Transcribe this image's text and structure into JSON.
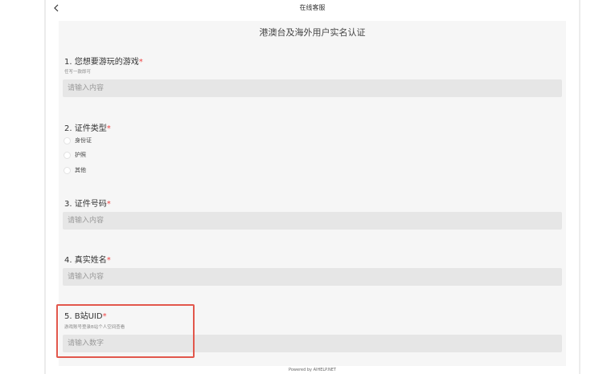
{
  "header": {
    "title": "在线客服"
  },
  "form": {
    "title": "港澳台及海外用户实名认证",
    "required_mark": "*",
    "questions": [
      {
        "label": "1. 您想要游玩的游戏",
        "hint": "任写一款即可",
        "placeholder": "请输入内容"
      },
      {
        "label": "2. 证件类型",
        "options": [
          "身份证",
          "护照",
          "其他"
        ]
      },
      {
        "label": "3. 证件号码",
        "placeholder": "请输入内容"
      },
      {
        "label": "4. 真实姓名",
        "placeholder": "请输入内容"
      },
      {
        "label": "5. B站UID",
        "hint": "游戏账号登录B站个人空间查看",
        "placeholder": "请输入数字"
      }
    ]
  },
  "footer": {
    "text": "Powered by AIHELP.NET"
  },
  "colors": {
    "required": "#e44444",
    "highlight": "#e2574c",
    "input_bg": "#e6e6e6",
    "form_bg": "#f6f6f6"
  },
  "icons": {
    "back": "chevron-left-icon"
  }
}
